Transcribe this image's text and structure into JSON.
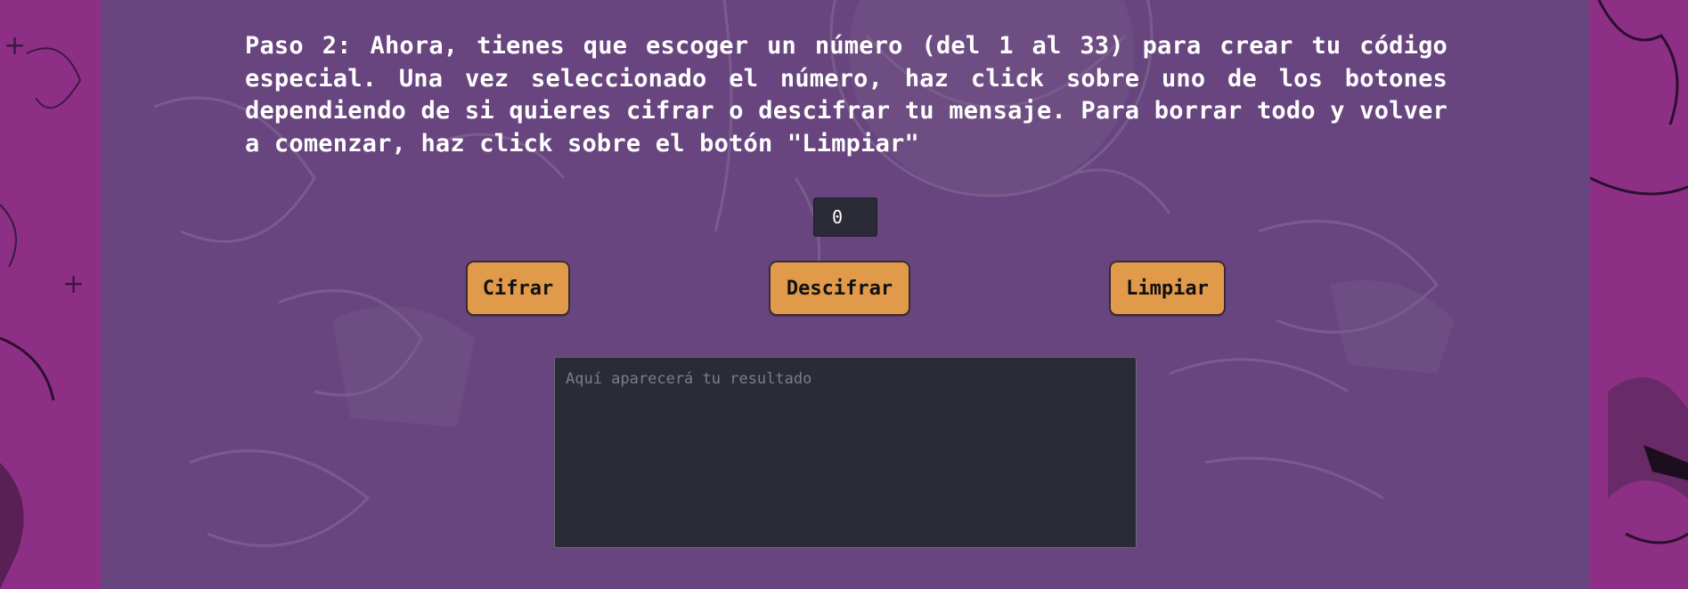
{
  "page": {
    "background_color": "#8e2f86",
    "panel_color": "#68457f",
    "accent_button_color": "#e09a4a",
    "field_color": "#2a2b36"
  },
  "instructions": {
    "text": "Paso 2: Ahora, tienes que escoger un número (del 1 al 33) para crear tu código especial. Una vez seleccionado el número, haz click sobre uno de los botones dependiendo de si quieres cifrar o descifrar tu mensaje. Para borrar todo y volver a comenzar, haz click sobre el botón \"Limpiar\""
  },
  "number_input": {
    "value": "0"
  },
  "buttons": {
    "cifrar": "Cifrar",
    "descifrar": "Descifrar",
    "limpiar": "Limpiar"
  },
  "result": {
    "value": "",
    "placeholder": "Aquí aparecerá tu resultado"
  }
}
